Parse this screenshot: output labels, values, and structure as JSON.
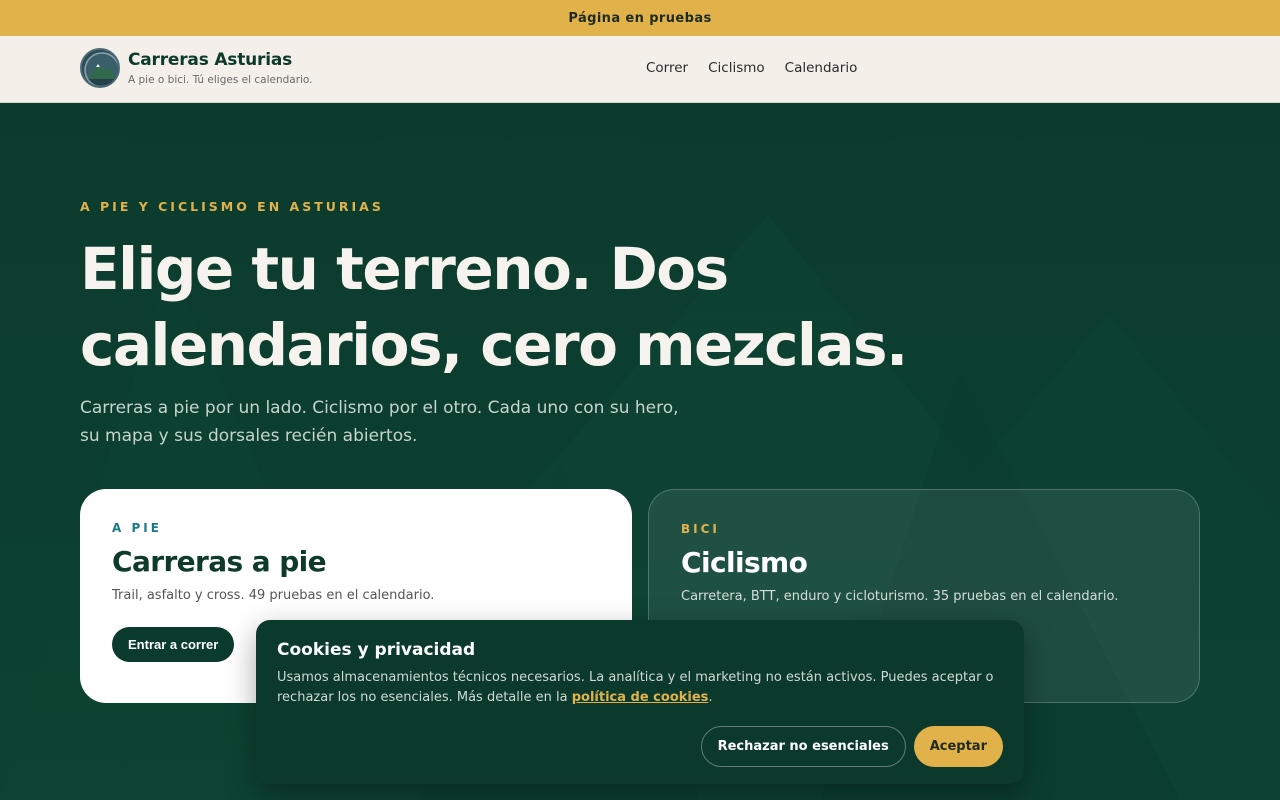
{
  "topbar": {
    "text": "Página en pruebas"
  },
  "brand": {
    "name": "Carreras Asturias",
    "tagline": "A pie o bici. Tú eliges el calendario.",
    "logo_icon": "mountain-badge-icon"
  },
  "nav": {
    "items": [
      "Correr",
      "Ciclismo",
      "Calendario"
    ]
  },
  "hero": {
    "eyebrow": "A PIE Y CICLISMO EN ASTURIAS",
    "headline": "Elige tu terreno. Dos calendarios, cero mezclas.",
    "lead": "Carreras a pie por un lado. Ciclismo por el otro. Cada uno con su hero, su mapa y sus dorsales recién abiertos."
  },
  "cards": {
    "run": {
      "kicker": "A PIE",
      "title": "Carreras a pie",
      "desc": "Trail, asfalto y cross. 49 pruebas en el calendario.",
      "button": "Entrar a correr"
    },
    "bike": {
      "kicker": "BICI",
      "title": "Ciclismo",
      "desc": "Carretera, BTT, enduro y cicloturismo. 35 pruebas en el calendario."
    }
  },
  "cookie": {
    "title": "Cookies y privacidad",
    "text": "Usamos almacenamientos técnicos necesarios. La analítica y el marketing no están activos. Puedes aceptar o rechazar los no esenciales. Más detalle en la",
    "link": "política de cookies",
    "period": ".",
    "reject": "Rechazar no esenciales",
    "accept": "Aceptar"
  },
  "colors": {
    "accent": "#e2b24a",
    "forest": "#0b3b2d",
    "cream": "#f4efe8"
  }
}
